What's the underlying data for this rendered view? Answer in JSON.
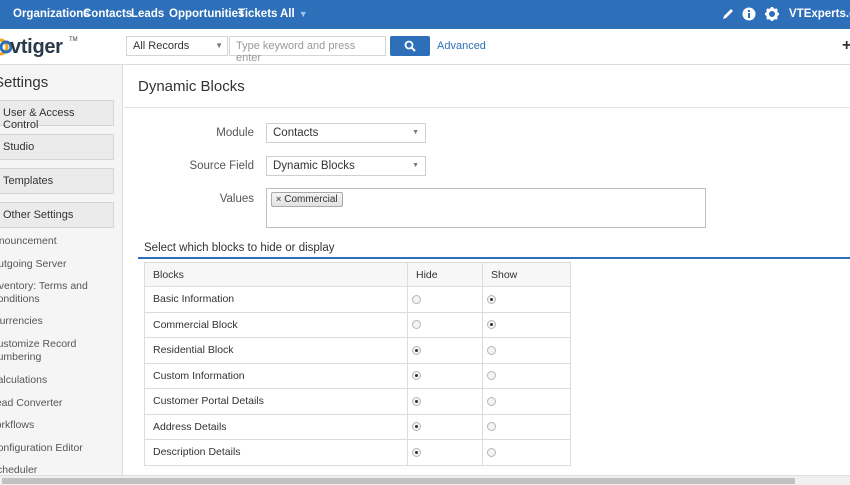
{
  "topnav": {
    "items": [
      "Organizations",
      "Contacts",
      "Leads",
      "Opportunities",
      "Tickets",
      "All"
    ],
    "user": "VTExperts.com",
    "color": "#2e6fba"
  },
  "header": {
    "logo": "vtiger",
    "filter_value": "All Records",
    "search_placeholder": "Type keyword and press enter",
    "advanced_label": "Advanced",
    "quick_create": "+"
  },
  "sidebar": {
    "title": "Settings",
    "blocks": [
      "User & Access Control",
      "Studio",
      "Templates",
      "Other Settings"
    ],
    "links": [
      "Announcement",
      "Outgoing Server",
      "Inventory: Terms and Conditions",
      "Currencies",
      "Customize Record Numbering",
      "Calculations",
      "Lead Converter",
      "Workflows",
      "Configuration Editor",
      "Scheduler"
    ]
  },
  "main": {
    "title": "Dynamic Blocks",
    "form": {
      "module_label": "Module",
      "module_value": "Contacts",
      "source_label": "Source Field",
      "source_value": "Dynamic Blocks",
      "values_label": "Values",
      "values_tags": [
        "Commercial"
      ]
    },
    "section_title": "Select which blocks to hide or display",
    "table": {
      "headers": [
        "Blocks",
        "Hide",
        "Show"
      ],
      "rows": [
        {
          "name": "Basic Information",
          "selected": "show"
        },
        {
          "name": "Commercial Block",
          "selected": "show"
        },
        {
          "name": "Residential Block",
          "selected": "hide"
        },
        {
          "name": "Custom Information",
          "selected": "hide"
        },
        {
          "name": "Customer Portal Details",
          "selected": "hide"
        },
        {
          "name": "Address Details",
          "selected": "hide"
        },
        {
          "name": "Description Details",
          "selected": "hide"
        }
      ]
    }
  }
}
